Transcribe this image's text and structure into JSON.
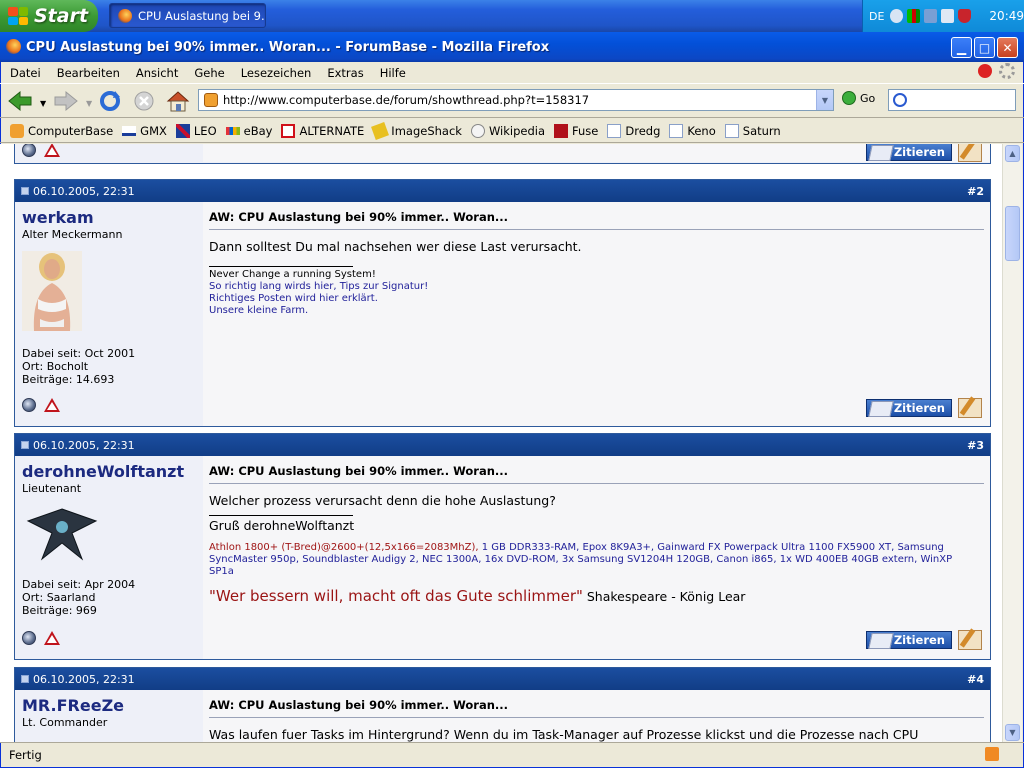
{
  "taskbar": {
    "start_label": "Start",
    "task_label": "CPU Auslastung bei 9...",
    "tray_lang": "DE",
    "clock": "20:49"
  },
  "window": {
    "title": "CPU Auslastung bei 90% immer.. Woran... - ForumBase - Mozilla Firefox"
  },
  "menu": [
    "Datei",
    "Bearbeiten",
    "Ansicht",
    "Gehe",
    "Lesezeichen",
    "Extras",
    "Hilfe"
  ],
  "navbar": {
    "url": "http://www.computerbase.de/forum/showthread.php?t=158317",
    "go_label": "Go"
  },
  "bookmarks": [
    "ComputerBase",
    "GMX",
    "LEO",
    "eBay",
    "ALTERNATE",
    "ImageShack",
    "Wikipedia",
    "Fuse",
    "Dredg",
    "Keno",
    "Saturn"
  ],
  "quote_button": "Zitieren",
  "posts": [
    {
      "date": "06.10.2005, 22:31",
      "number": "#2",
      "user": "werkam",
      "rank": "Alter Meckermann",
      "info": [
        "Dabei seit: Oct 2001",
        "Ort: Bocholt",
        "Beiträge: 14.693"
      ],
      "title": "AW: CPU Auslastung bei 90% immer.. Woran...",
      "text": "Dann solltest Du mal nachsehen wer diese Last verursacht.",
      "sig_plain": "Never Change a running System!",
      "sig_links": [
        "So richtig lang wirds hier, Tips zur Signatur!",
        "Richtiges Posten wird hier erklärt.",
        "Unsere kleine Farm."
      ]
    },
    {
      "date": "06.10.2005, 22:31",
      "number": "#3",
      "user": "derohneWolftanzt",
      "rank": "Lieutenant",
      "info": [
        "Dabei seit: Apr 2004",
        "Ort: Saarland",
        "Beiträge: 969"
      ],
      "title": "AW: CPU Auslastung bei 90% immer.. Woran...",
      "text": "Welcher prozess verursacht denn die hohe Auslastung?",
      "greeting": "Gruß derohneWolftanzt",
      "sig_red": "Athlon 1800+ (T-Bred)@2600+(12,5x166=2083MhZ),",
      "sig_blue": " 1 GB DDR333-RAM, Epox 8K9A3+, Gainward FX Powerpack Ultra 1100 FX5900 XT, Samsung SyncMaster 950p, Soundblaster Audigy 2, NEC 1300A, 16x DVD-ROM, 3x Samsung SV1204H 120GB, Canon i865, 1x WD 400EB 40GB extern, WinXP SP1a",
      "quote": "\"Wer bessern will, macht oft das Gute schlimmer\"",
      "quote_author": " Shakespeare - König Lear"
    },
    {
      "date": "06.10.2005, 22:31",
      "number": "#4",
      "user": "MR.FReeZe",
      "rank": "Lt. Commander",
      "title": "AW: CPU Auslastung bei 90% immer.. Woran...",
      "text": "Was laufen fuer Tasks im Hintergrund? Wenn du im Task-Manager auf Prozesse klickst und die Prozesse nach CPU auslastung sortieren laesst dann siehst du was am meisten performance benoetigt."
    }
  ],
  "status": "Fertig"
}
